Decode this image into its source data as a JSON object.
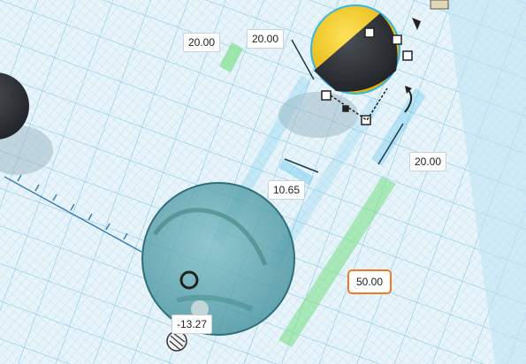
{
  "workplane": {
    "grid_color": "#9fd3ea",
    "background": "#e8f4fa"
  },
  "dimensions": {
    "sphere_width": "20.00",
    "sphere_depth": "20.00",
    "sphere_height": "20.00",
    "offset_x": "10.65",
    "elevation": "50.00",
    "ruler_readout": "-13.27"
  },
  "colors": {
    "selection_accent": "#f07a24",
    "guide_blue": "#5bc2ec",
    "height_guide_green": "#7fe08a",
    "yellow_sphere": "#f4c400",
    "dark_sphere": "#2b2f33",
    "hole_sphere": "#5aa6b0"
  },
  "icons": {
    "rotate_handle": "rotate-arrow-icon",
    "move_handle": "move-up-cone-icon",
    "ruler_origin": "ruler-origin-icon"
  }
}
